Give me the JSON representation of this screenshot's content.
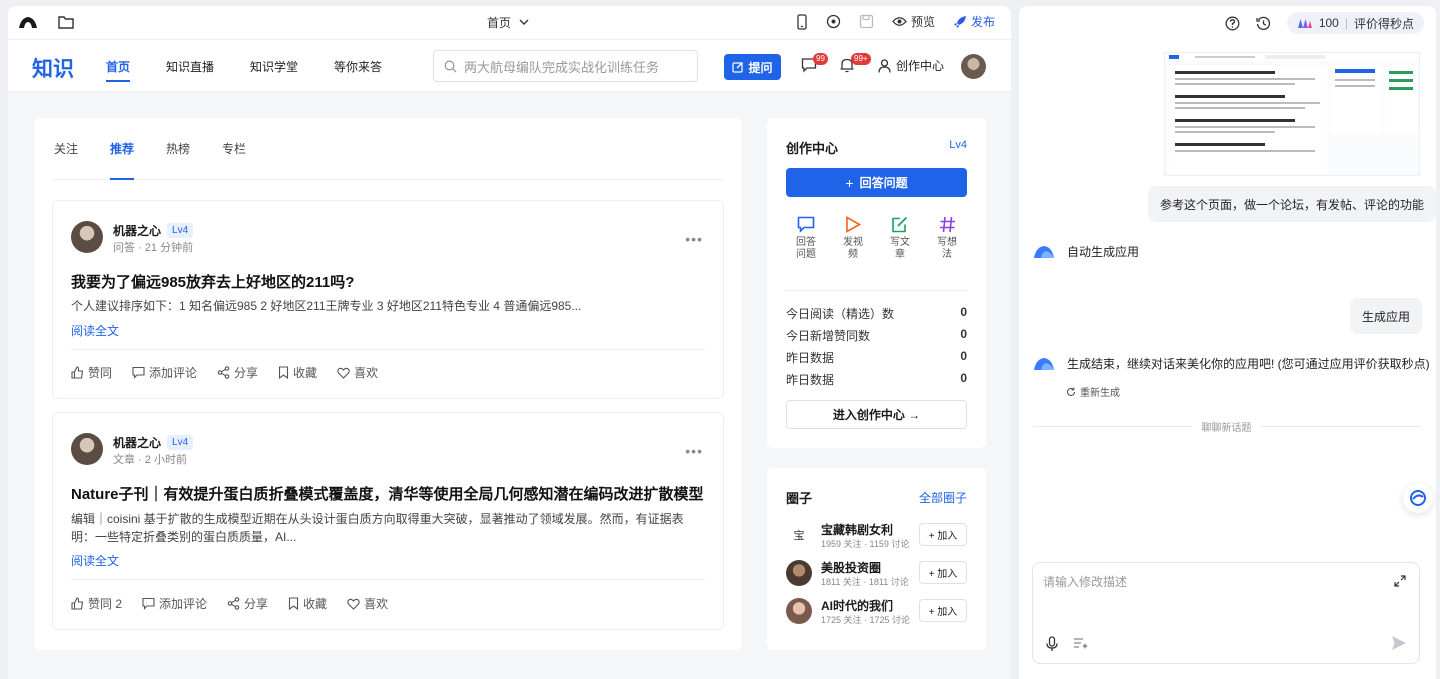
{
  "editor_topbar": {
    "page_selector": "首页",
    "preview_label": "预览",
    "publish_label": "发布"
  },
  "site": {
    "brand": "知识",
    "nav": [
      "首页",
      "知识直播",
      "知识学堂",
      "等你来答"
    ],
    "search_placeholder": "两大航母编队完成实战化训练任务",
    "ask_button": "提问",
    "message_badge": "99",
    "notify_badge": "99+",
    "creator_center": "创作中心"
  },
  "feed": {
    "tabs": [
      "关注",
      "推荐",
      "热榜",
      "专栏"
    ],
    "active_tab": "推荐",
    "posts": [
      {
        "author": "机器之心",
        "level": "Lv4",
        "meta": "问答 · 21 分钟前",
        "title": "我要为了偏远985放弃去上好地区的211吗?",
        "excerpt": "个人建议排序如下：1 知名偏远985 2 好地区211王牌专业 3 好地区211特色专业 4 普通偏远985...",
        "read_all": "阅读全文",
        "actions": [
          "赞同",
          "添加评论",
          "分享",
          "收藏",
          "喜欢"
        ]
      },
      {
        "author": "机器之心",
        "level": "Lv4",
        "meta": "文章 · 2 小时前",
        "title": "Nature子刊｜有效提升蛋白质折叠模式覆盖度，清华等使用全局几何感知潜在编码改进扩散模型",
        "excerpt": "编辑｜coisini 基于扩散的生成模型近期在从头设计蛋白质方向取得重大突破，显著推动了领域发展。然而，有证据表明：一些特定折叠类别的蛋白质质量，AI...",
        "read_all": "阅读全文",
        "actions": [
          "赞同 2",
          "添加评论",
          "分享",
          "收藏",
          "喜欢"
        ]
      }
    ]
  },
  "creator_panel": {
    "title": "创作中心",
    "level": "Lv4",
    "answer_button": "回答问题",
    "quick_actions": [
      "回答问题",
      "发视频",
      "写文章",
      "写想法"
    ],
    "stats": [
      {
        "label": "今日阅读（精选）数",
        "value": "0"
      },
      {
        "label": "今日新增赞同数",
        "value": "0"
      },
      {
        "label": "昨日数据",
        "value": "0"
      },
      {
        "label": "昨日数据",
        "value": "0"
      }
    ],
    "enter_button": "进入创作中心 →"
  },
  "circles_panel": {
    "title": "圈子",
    "all_link": "全部圈子",
    "broken_avatar_text": "宝",
    "items": [
      {
        "name": "宝藏韩剧女利",
        "meta": "1959 关注 · 1159 讨论",
        "join": "+ 加入"
      },
      {
        "name": "美股投资圈",
        "meta": "1811 关注 · 1811 讨论",
        "join": "+ 加入"
      },
      {
        "name": "AI时代的我们",
        "meta": "1725 关注 · 1725 讨论",
        "join": "+ 加入"
      }
    ]
  },
  "chat": {
    "credit_value": "100",
    "credit_label": "评价得秒点",
    "messages": {
      "user1": "参考这个页面，做一个论坛，有发帖、评论的功能",
      "bot1": "自动生成应用",
      "user2": "生成应用",
      "bot2": "生成结束，继续对话来美化你的应用吧! (您可通过应用评价获取秒点)"
    },
    "regenerate": "重新生成",
    "new_topic": "聊聊新话题",
    "input_placeholder": "请输入修改描述"
  },
  "colors": {
    "accent": "#1f63e8",
    "badge": "#e23a3a"
  }
}
